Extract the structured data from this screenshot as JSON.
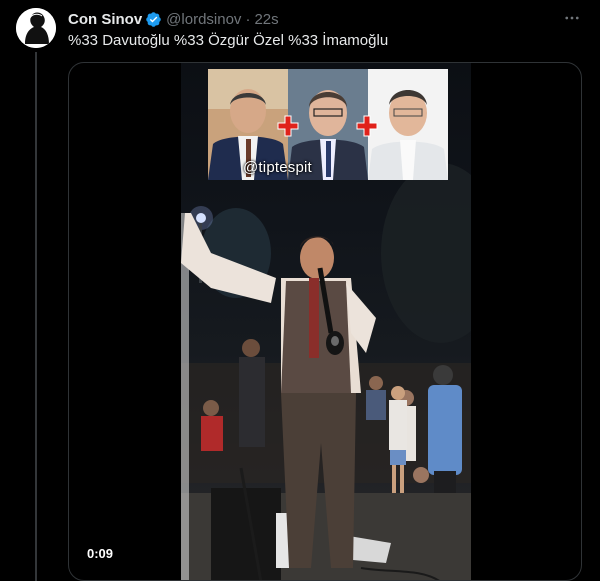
{
  "tweet": {
    "author_name": "Con Sinov",
    "handle": "@lordsinov",
    "separator": "·",
    "time": "22s",
    "text": "%33 Davutoğlu %33 Özgür Özel %33 İmamoğlu",
    "verified_icon": "verified-badge-icon",
    "more_icon": "more-dots-icon"
  },
  "media": {
    "watermark": "@tiptespit",
    "duration": "0:09",
    "plus_icon": "red-plus-icon",
    "accent_red": "#e0221b"
  },
  "colors": {
    "background": "#000000",
    "text_primary": "#e7e9ea",
    "text_secondary": "#71767b",
    "verified_blue": "#1d9bf0",
    "border": "#2f3336"
  }
}
